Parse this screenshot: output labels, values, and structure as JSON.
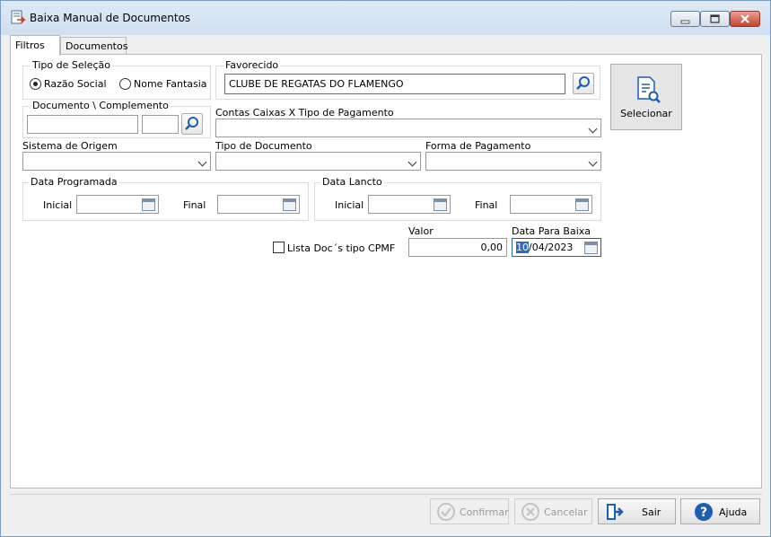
{
  "window": {
    "title": "Baixa Manual de Documentos"
  },
  "tabs": [
    {
      "label": "Filtros"
    },
    {
      "label": "Documentos"
    }
  ],
  "filtros": {
    "tipo_selecao": {
      "title": "Tipo de Seleção",
      "options": [
        {
          "label": "Razão Social",
          "checked": true
        },
        {
          "label": "Nome Fantasia",
          "checked": false
        }
      ]
    },
    "favorecido": {
      "title": "Favorecido",
      "value": "CLUBE DE REGATAS DO FLAMENGO"
    },
    "documento": {
      "title": "Documento \\ Complemento",
      "value": "",
      "complemento": ""
    },
    "contas_caixas": {
      "label": "Contas Caixas X Tipo de Pagamento",
      "value": ""
    },
    "sistema_origem": {
      "label": "Sistema de Origem",
      "value": ""
    },
    "tipo_documento": {
      "label": "Tipo de Documento",
      "value": ""
    },
    "forma_pagamento": {
      "label": "Forma de Pagamento",
      "value": ""
    },
    "data_programada": {
      "title": "Data Programada",
      "inicial_label": "Inicial",
      "final_label": "Final",
      "inicial": "",
      "final": ""
    },
    "data_lancto": {
      "title": "Data Lancto",
      "inicial_label": "Inicial",
      "final_label": "Final",
      "inicial": "",
      "final": ""
    },
    "lista_cpmf": {
      "label": "Lista Doc´s tipo CPMF",
      "checked": false
    },
    "valor": {
      "label": "Valor",
      "value": "0,00"
    },
    "data_baixa": {
      "label": "Data Para Baixa",
      "day": "10",
      "rest": "/04/2023"
    },
    "selecionar": {
      "label": "Selecionar"
    }
  },
  "footer": {
    "confirmar": "Confirmar",
    "cancelar": "Cancelar",
    "sair": "Sair",
    "ajuda": "Ajuda"
  },
  "colors": {
    "accent": "#1a5fb4",
    "selection": "#316ac5",
    "close": "#c7432c"
  }
}
